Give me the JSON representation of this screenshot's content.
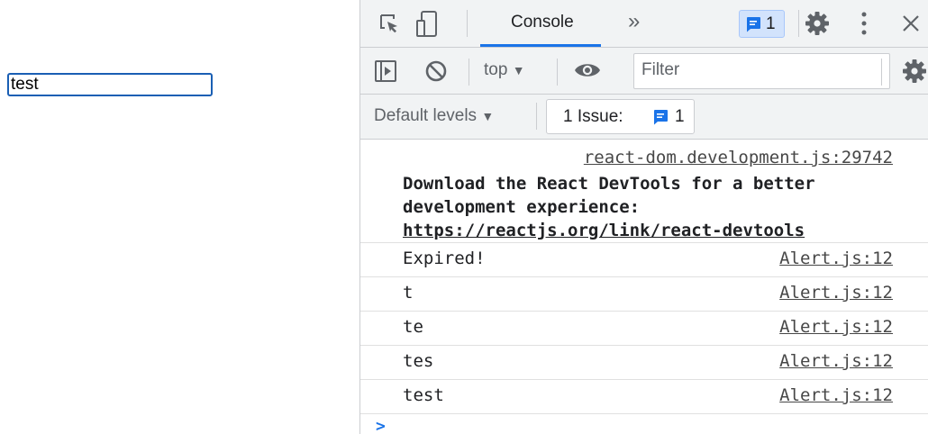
{
  "page": {
    "input_value": "test"
  },
  "devtools": {
    "tabs": {
      "active_label": "Console",
      "more_label": "»"
    },
    "issues_badge": {
      "count": "1"
    },
    "toolbar": {
      "context_label": "top",
      "filter_placeholder": "Filter"
    },
    "levels": {
      "label": "Default levels",
      "issues_label": "1 Issue:",
      "issues_count": "1"
    },
    "console": {
      "devtools_source": "react-dom.development.js:29742",
      "devtools_message": "Download the React DevTools for a better development experience: ",
      "devtools_url": "https://reactjs.org/link/react-devtools",
      "entries": [
        {
          "message": "Expired!",
          "source": "Alert.js:12"
        },
        {
          "message": "t",
          "source": "Alert.js:12"
        },
        {
          "message": "te",
          "source": "Alert.js:12"
        },
        {
          "message": "tes",
          "source": "Alert.js:12"
        },
        {
          "message": "test",
          "source": "Alert.js:12"
        }
      ],
      "prompt": ">"
    },
    "colors": {
      "accent": "#1a73e8",
      "badge_bg": "#d2e3fc"
    }
  }
}
